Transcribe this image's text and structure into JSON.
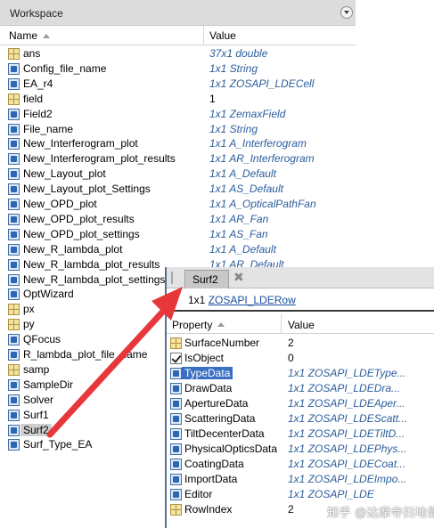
{
  "workspace": {
    "title": "Workspace",
    "col_name": "Name",
    "col_value": "Value",
    "rows": [
      {
        "name": "ans",
        "value": "37x1 double",
        "icon": "numeric-array-icon",
        "plain": false
      },
      {
        "name": "Config_file_name",
        "value": "1x1 String",
        "icon": "object-icon",
        "plain": false
      },
      {
        "name": "EA_r4",
        "value": "1x1 ZOSAPI_LDECell",
        "icon": "object-icon",
        "plain": false
      },
      {
        "name": "field",
        "value": "1",
        "icon": "numeric-array-icon",
        "plain": true
      },
      {
        "name": "Field2",
        "value": "1x1 ZemaxField",
        "icon": "object-icon",
        "plain": false
      },
      {
        "name": "File_name",
        "value": "1x1 String",
        "icon": "object-icon",
        "plain": false
      },
      {
        "name": "New_Interferogram_plot",
        "value": "1x1 A_Interferogram",
        "icon": "object-icon",
        "plain": false
      },
      {
        "name": "New_Interferogram_plot_results",
        "value": "1x1 AR_Interferogram",
        "icon": "object-icon",
        "plain": false
      },
      {
        "name": "New_Layout_plot",
        "value": "1x1 A_Default",
        "icon": "object-icon",
        "plain": false
      },
      {
        "name": "New_Layout_plot_Settings",
        "value": "1x1 AS_Default",
        "icon": "object-icon",
        "plain": false
      },
      {
        "name": "New_OPD_plot",
        "value": "1x1 A_OpticalPathFan",
        "icon": "object-icon",
        "plain": false
      },
      {
        "name": "New_OPD_plot_results",
        "value": "1x1 AR_Fan",
        "icon": "object-icon",
        "plain": false
      },
      {
        "name": "New_OPD_plot_settings",
        "value": "1x1 AS_Fan",
        "icon": "object-icon",
        "plain": false
      },
      {
        "name": "New_R_lambda_plot",
        "value": "1x1 A_Default",
        "icon": "object-icon",
        "plain": false
      },
      {
        "name": "New_R_lambda_plot_results",
        "value": "1x1 AR_Default",
        "icon": "object-icon",
        "plain": false
      },
      {
        "name": "New_R_lambda_plot_settings",
        "value": "",
        "icon": "object-icon",
        "plain": false
      },
      {
        "name": "OptWizard",
        "value": "",
        "icon": "object-icon",
        "plain": false
      },
      {
        "name": "px",
        "value": "",
        "icon": "numeric-array-icon",
        "plain": false
      },
      {
        "name": "py",
        "value": "",
        "icon": "numeric-array-icon",
        "plain": false
      },
      {
        "name": "QFocus",
        "value": "",
        "icon": "object-icon",
        "plain": false
      },
      {
        "name": "R_lambda_plot_file_name",
        "value": "",
        "icon": "object-icon",
        "plain": false
      },
      {
        "name": "samp",
        "value": "",
        "icon": "numeric-array-icon",
        "plain": false
      },
      {
        "name": "SampleDir",
        "value": "",
        "icon": "object-icon",
        "plain": false
      },
      {
        "name": "Solver",
        "value": "",
        "icon": "object-icon",
        "plain": false
      },
      {
        "name": "Surf1",
        "value": "",
        "icon": "object-icon",
        "plain": false
      },
      {
        "name": "Surf2",
        "value": "",
        "icon": "object-icon",
        "plain": false,
        "selected": true
      },
      {
        "name": "Surf_Type_EA",
        "value": "",
        "icon": "object-icon",
        "plain": false
      }
    ]
  },
  "variable_editor": {
    "tab_label": "Surf2",
    "size_prefix": "1x1",
    "class_name": "ZOSAPI_LDERow",
    "col_property": "Property",
    "col_value": "Value",
    "properties": [
      {
        "name": "SurfaceNumber",
        "value": "2",
        "icon": "numeric-array-icon",
        "plain": true
      },
      {
        "name": "IsObject",
        "value": "0",
        "icon": "checkbox-icon",
        "plain": true
      },
      {
        "name": "TypeData",
        "value": "1x1 ZOSAPI_LDEType...",
        "icon": "object-icon",
        "plain": false,
        "selected": true
      },
      {
        "name": "DrawData",
        "value": "1x1 ZOSAPI_LDEDra...",
        "icon": "object-icon",
        "plain": false
      },
      {
        "name": "ApertureData",
        "value": "1x1 ZOSAPI_LDEAper...",
        "icon": "object-icon",
        "plain": false
      },
      {
        "name": "ScatteringData",
        "value": "1x1 ZOSAPI_LDEScatt...",
        "icon": "object-icon",
        "plain": false
      },
      {
        "name": "TiltDecenterData",
        "value": "1x1 ZOSAPI_LDETiltD...",
        "icon": "object-icon",
        "plain": false
      },
      {
        "name": "PhysicalOpticsData",
        "value": "1x1 ZOSAPI_LDEPhys...",
        "icon": "object-icon",
        "plain": false
      },
      {
        "name": "CoatingData",
        "value": "1x1 ZOSAPI_LDECoat...",
        "icon": "object-icon",
        "plain": false
      },
      {
        "name": "ImportData",
        "value": "1x1 ZOSAPI_LDEImpo...",
        "icon": "object-icon",
        "plain": false
      },
      {
        "name": "Editor",
        "value": "1x1 ZOSAPI_LDE",
        "icon": "object-icon",
        "plain": false
      },
      {
        "name": "RowIndex",
        "value": "2",
        "icon": "numeric-array-icon",
        "plain": true
      }
    ]
  },
  "annotation": {
    "arrow_color": "#e8373a"
  },
  "watermark": "知乎 @达摩寺扫地僧"
}
